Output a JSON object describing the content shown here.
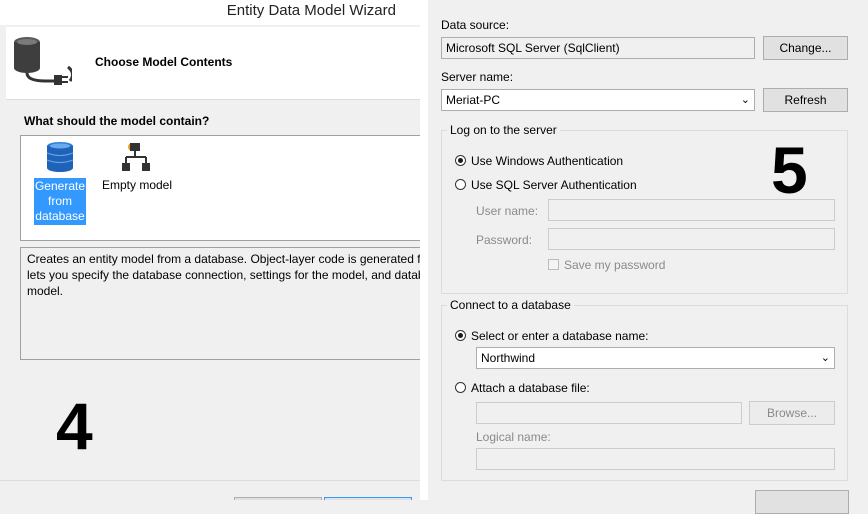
{
  "left": {
    "window_title": "Entity Data Model Wizard",
    "header_title": "Choose Model Contents",
    "question": "What should the model contain?",
    "options": [
      {
        "label_lines": [
          "Generate",
          "from",
          "database"
        ],
        "selected": true
      },
      {
        "label_lines": [
          "Empty model"
        ],
        "selected": false
      }
    ],
    "description_lines": [
      "Creates an entity model from a database. Object-layer code is generated fro",
      "lets you specify the database connection, settings for the model, and datab",
      "model."
    ],
    "step_number": "4"
  },
  "right": {
    "data_source_label": "Data source:",
    "data_source_value": "Microsoft SQL Server (SqlClient)",
    "change_button": "Change...",
    "server_name_label": "Server name:",
    "server_name_value": "Meriat-PC",
    "refresh_button": "Refresh",
    "logon_group_title": "Log on to the server",
    "use_windows_auth": "Use Windows Authentication",
    "use_sql_auth": "Use SQL Server Authentication",
    "user_name_label": "User name:",
    "password_label": "Password:",
    "save_password_label": "Save my password",
    "step_number": "5",
    "connect_group_title": "Connect to a database",
    "select_db_label": "Select or enter a database name:",
    "db_name_value": "Northwind",
    "attach_db_label": "Attach a database file:",
    "browse_button": "Browse...",
    "logical_name_label": "Logical name:",
    "auth_selected": "windows",
    "db_mode_selected": "select"
  }
}
